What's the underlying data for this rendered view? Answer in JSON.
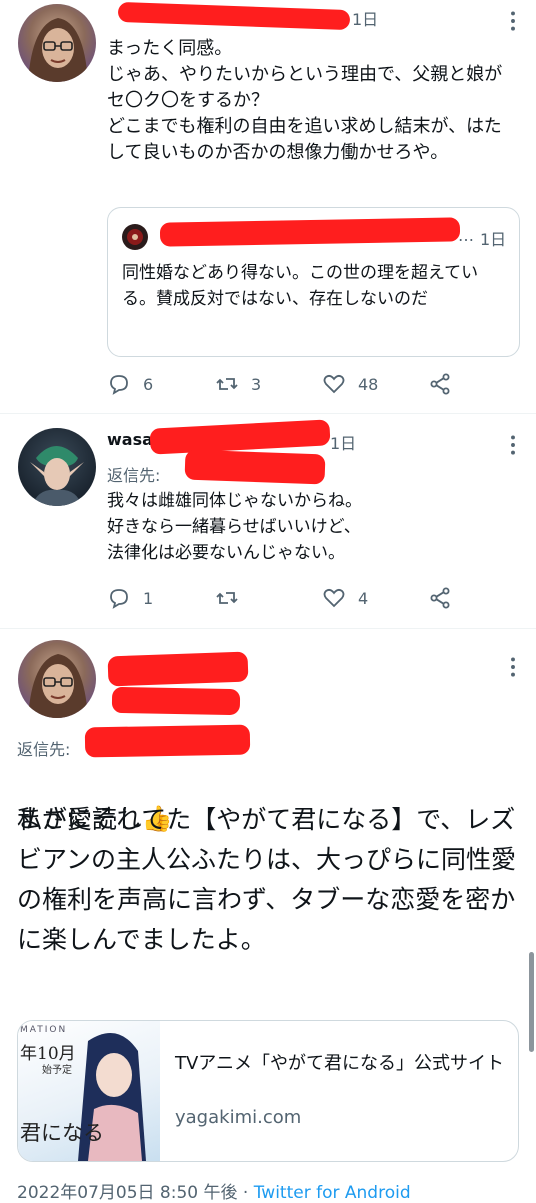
{
  "tweet1": {
    "avatar": "avatar-glasses-woman",
    "time": "1日",
    "text": "まったく同感。\nじゃあ、やりたいからという理由で、父親と娘がセ〇ク〇をするか？\nどこまでも権利の自由を追い求めし結末が、はたして良いものか否かの想像力働かせろや。",
    "quote": {
      "ellipsis": "…",
      "time": "1日",
      "text": "同性婚などあり得ない。この世の理を超えている。賛成反対ではない、存在しないのだ"
    },
    "actions": {
      "replies": "6",
      "retweets": "3",
      "likes": "48"
    }
  },
  "tweet2": {
    "avatar": "avatar-elf",
    "name_fragment": "wasad",
    "time": "1日",
    "reply_prefix": "返信先: ",
    "text": "我々は雌雄同体じゃないからね。\n好きなら一緒暮らせばいいけど、\n法律化は必要ないんじゃない。",
    "actions": {
      "replies": "1",
      "retweets": "",
      "likes": "4"
    }
  },
  "tweet3": {
    "avatar": "avatar-glasses-woman",
    "reply_prefix": "返信先: ",
    "text": "まさにそれ",
    "emoji": "👍",
    "body": "私が愛読してた【やがて君になる】で、レズビアンの主人公ふたりは、大っぴらに同性愛の権利を声高に言わず、タブーな恋愛を密かに楽しんでましたよ。",
    "card": {
      "thumb_lines": [
        "MATION",
        "年10月",
        "始予定",
        "君になる"
      ],
      "title": "TVアニメ「やがて君になる」公式サイト",
      "domain": "yagakimi.com"
    },
    "timestamp": "2022年07月05日 8:50 午後",
    "separator": "·",
    "source": "Twitter for Android"
  },
  "colors": {
    "accent": "#1d9bf0",
    "muted": "#536471",
    "redaction": "#ff1e1e",
    "border": "#cfd9de"
  }
}
